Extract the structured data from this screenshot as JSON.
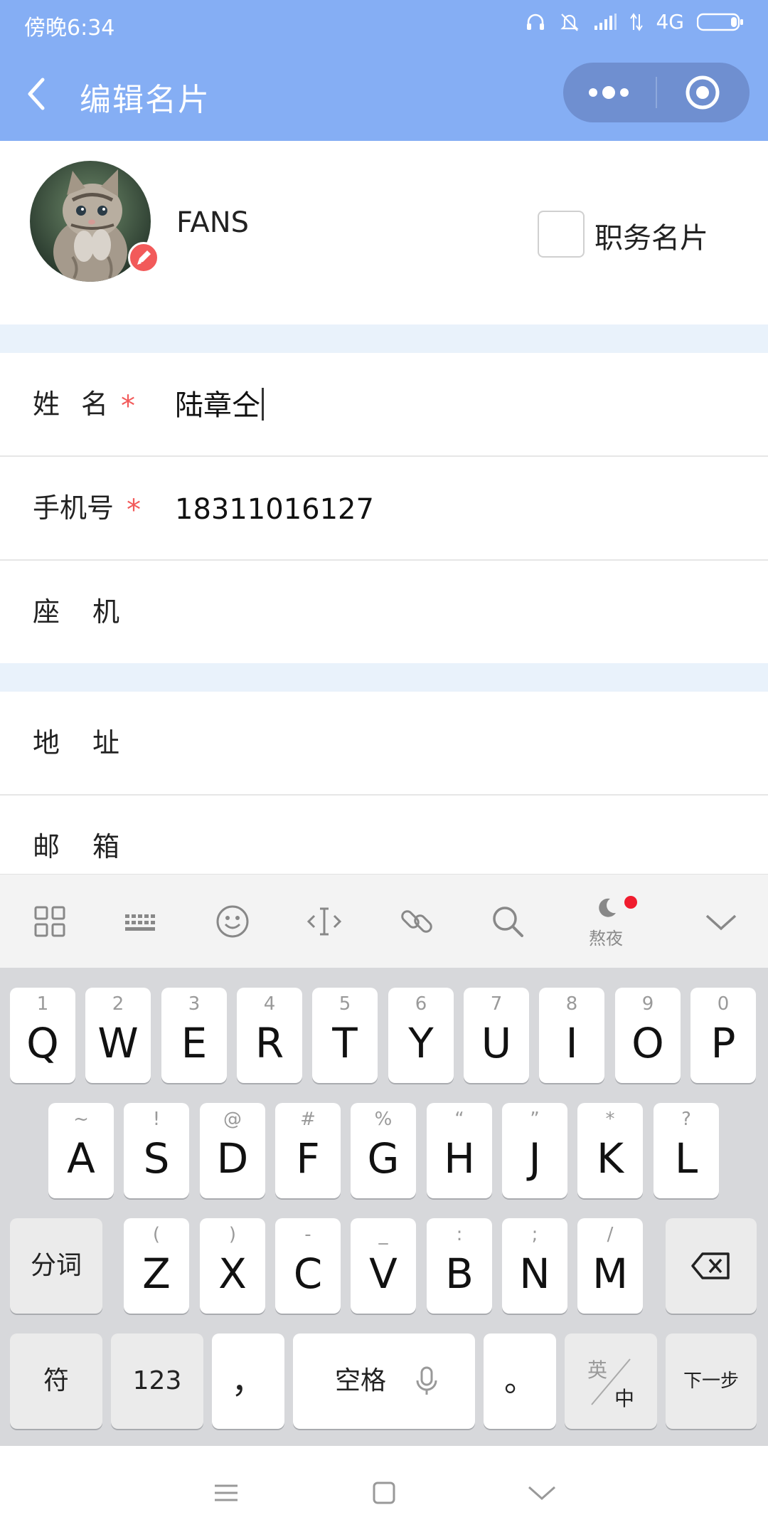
{
  "status_bar": {
    "time": "傍晚6:34",
    "network": "4G"
  },
  "header": {
    "title": "编辑名片",
    "back_icon": "chevron-left-icon",
    "capsule": {
      "more_icon": "more-dots-icon",
      "close_icon": "target-close-icon"
    }
  },
  "profile": {
    "nickname": "FANS",
    "duty_card_label": "职务名片",
    "duty_card_checked": false,
    "avatar_icon": "cat-avatar",
    "edit_icon": "pencil-icon"
  },
  "form": {
    "rows": [
      {
        "label": "姓名",
        "required": true,
        "value": "陆章仝"
      },
      {
        "label": "手机号",
        "required": true,
        "value": "18311016127"
      },
      {
        "label": "座机",
        "required": false,
        "value": ""
      },
      {
        "label": "地址",
        "required": false,
        "value": ""
      },
      {
        "label": "邮箱",
        "required": false,
        "value": ""
      }
    ],
    "required_mark": "*"
  },
  "keyboard": {
    "toolbar": {
      "icons": [
        "grid-icon",
        "keyboard-icon",
        "emoji-icon",
        "cursor-icon",
        "link-icon",
        "search-icon",
        "moon-icon",
        "chevron-down-icon"
      ],
      "night_label": "熬夜",
      "accent": "#f01c2e"
    },
    "row1": [
      {
        "k": "Q",
        "s": "1"
      },
      {
        "k": "W",
        "s": "2"
      },
      {
        "k": "E",
        "s": "3"
      },
      {
        "k": "R",
        "s": "4"
      },
      {
        "k": "T",
        "s": "5"
      },
      {
        "k": "Y",
        "s": "6"
      },
      {
        "k": "U",
        "s": "7"
      },
      {
        "k": "I",
        "s": "8"
      },
      {
        "k": "O",
        "s": "9"
      },
      {
        "k": "P",
        "s": "0"
      }
    ],
    "row2": [
      {
        "k": "A",
        "s": "~"
      },
      {
        "k": "S",
        "s": "!"
      },
      {
        "k": "D",
        "s": "@"
      },
      {
        "k": "F",
        "s": "#"
      },
      {
        "k": "G",
        "s": "%"
      },
      {
        "k": "H",
        "s": "“"
      },
      {
        "k": "J",
        "s": "”"
      },
      {
        "k": "K",
        "s": "*"
      },
      {
        "k": "L",
        "s": "?"
      }
    ],
    "row3": [
      {
        "k": "Z",
        "s": "("
      },
      {
        "k": "X",
        "s": ")"
      },
      {
        "k": "C",
        "s": "-"
      },
      {
        "k": "V",
        "s": "_"
      },
      {
        "k": "B",
        "s": ":"
      },
      {
        "k": "N",
        "s": ";"
      },
      {
        "k": "M",
        "s": "/"
      }
    ],
    "fenci": "分词",
    "fu": "符",
    "num": "123",
    "comma": "，",
    "space": "空格",
    "period": "。",
    "lang_en": "英",
    "lang_zh": "中",
    "next": "下一步"
  },
  "navbar": {
    "icons": [
      "menu-icon",
      "home-square-icon",
      "back-chevron-icon"
    ]
  },
  "colors": {
    "header_bg": "#85aef4",
    "required": "#f25a5a",
    "section_gap": "#e9f2fb"
  }
}
